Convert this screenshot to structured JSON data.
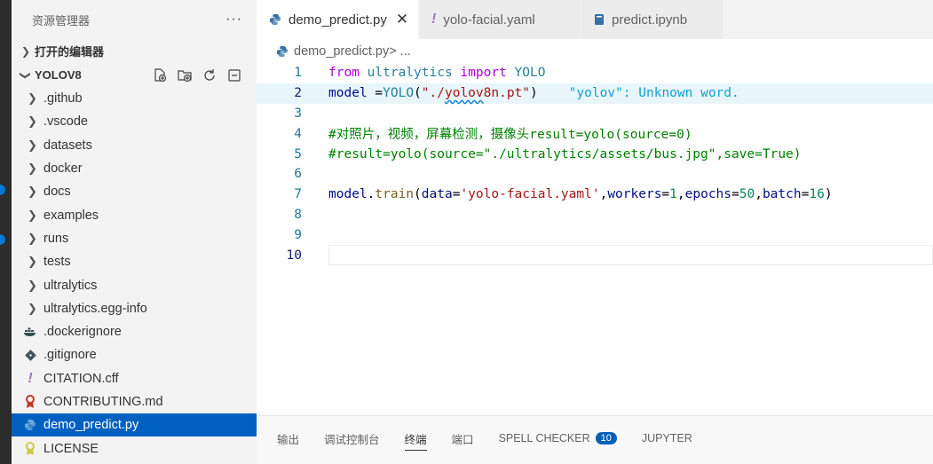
{
  "sidebar": {
    "title": "资源管理器",
    "more_label": "···",
    "open_editors": "打开的编辑器",
    "project": "YOLOV8",
    "items": [
      {
        "label": ".github",
        "kind": "folder"
      },
      {
        "label": ".vscode",
        "kind": "folder"
      },
      {
        "label": "datasets",
        "kind": "folder"
      },
      {
        "label": "docker",
        "kind": "folder"
      },
      {
        "label": "docs",
        "kind": "folder"
      },
      {
        "label": "examples",
        "kind": "folder"
      },
      {
        "label": "runs",
        "kind": "folder"
      },
      {
        "label": "tests",
        "kind": "folder"
      },
      {
        "label": "ultralytics",
        "kind": "folder"
      },
      {
        "label": "ultralytics.egg-info",
        "kind": "folder"
      },
      {
        "label": ".dockerignore",
        "kind": "file",
        "icon": "docker-icon"
      },
      {
        "label": ".gitignore",
        "kind": "file",
        "icon": "git-icon"
      },
      {
        "label": "CITATION.cff",
        "kind": "file",
        "icon": "exclamation-icon"
      },
      {
        "label": "CONTRIBUTING.md",
        "kind": "file",
        "icon": "ribbon-icon"
      },
      {
        "label": "demo_predict.py",
        "kind": "file",
        "icon": "python-icon",
        "selected": true
      },
      {
        "label": "LICENSE",
        "kind": "file",
        "icon": "license-icon"
      }
    ]
  },
  "tabs": [
    {
      "label": "demo_predict.py",
      "active": true,
      "close": "✕"
    },
    {
      "label": "yolo-facial.yaml"
    },
    {
      "label": "predict.ipynb"
    }
  ],
  "breadcrumb": {
    "file": "demo_predict.py",
    "sep": " > ..."
  },
  "code": {
    "line_numbers": [
      "1",
      "2",
      "3",
      "4",
      "5",
      "6",
      "7",
      "8",
      "9",
      "10"
    ],
    "l1": {
      "kw1": "from",
      "mod": " ultralytics ",
      "kw2": "import",
      "cls": " YOLO"
    },
    "l2": {
      "var": "model",
      "eq": " =",
      "cls": "YOLO",
      "p1": "(",
      "str1": "\"./",
      "str2": "yolov",
      "str3": "8n.pt\"",
      "p2": ")",
      "hint": "    \"yolov\": Unknown word."
    },
    "l4": "#对照片，视频，屏幕检测，摄像头result=yolo(source=0)",
    "l5": "#result=yolo(source=\"./ultralytics/assets/bus.jpg\",save=True)",
    "l7": {
      "var": "model",
      "dot": ".",
      "fn": "train",
      "p1": "(",
      "k1": "data",
      "eq1": "=",
      "s1": "'yolo-facial.yaml'",
      "c1": ",",
      "k2": "workers",
      "eq2": "=",
      "n1": "1",
      "c2": ",",
      "k3": "epochs",
      "eq3": "=",
      "n2": "50",
      "c3": ",",
      "k4": "batch",
      "eq4": "=",
      "n3": "16",
      "p2": ")"
    }
  },
  "panel": {
    "tabs": [
      "输出",
      "调试控制台",
      "终端",
      "端口",
      "SPELL CHECKER",
      "JUPYTER"
    ],
    "spell_badge": "10"
  },
  "colors": {
    "accent": "#0060c0",
    "badge": "#005fb8",
    "python_blue": "#3572a5",
    "yaml_purple": "#a074c4"
  }
}
